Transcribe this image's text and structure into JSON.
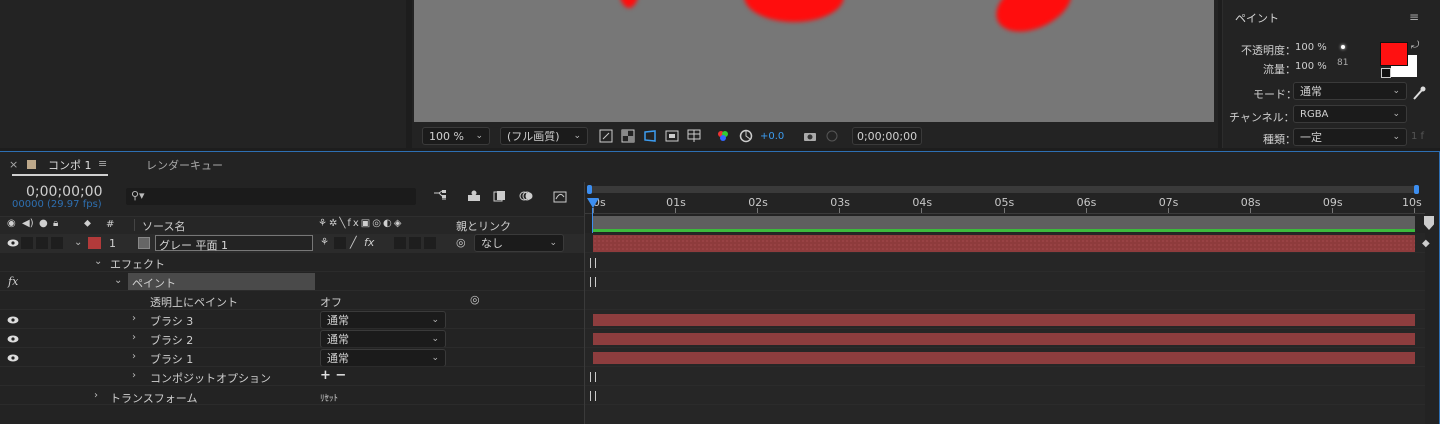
{
  "viewer": {
    "zoom": "100 %",
    "resolution": "(フル画質)",
    "exposure": "+0.0",
    "timecode": "0;00;00;00"
  },
  "paint_panel": {
    "title": "ペイント",
    "opacity_label": "不透明度：",
    "opacity_value": "100 %",
    "flow_label": "流量：",
    "flow_value": "100 %",
    "brush_size": "81",
    "mode_label": "モード：",
    "mode_value": "通常",
    "channel_label": "チャンネル：",
    "channel_value": "RGBA",
    "type_label": "種類：",
    "type_value": "一定",
    "type_extra": "1 f",
    "fg_color": "#ff0000",
    "bg_color": "#ffffff"
  },
  "tabs": {
    "comp": "コンポ 1",
    "render_queue": "レンダーキュー"
  },
  "timeline": {
    "current_time": "0;00;00;00",
    "frame_info": "00000 (29.97 fps)",
    "search_placeholder": "",
    "ruler": [
      "0s",
      "01s",
      "02s",
      "03s",
      "04s",
      "05s",
      "06s",
      "07s",
      "08s",
      "09s",
      "10s"
    ]
  },
  "columns": {
    "num": "#",
    "source_name": "ソース名",
    "parent_link": "親とリンク"
  },
  "layer": {
    "num": "1",
    "name": "グレー 平面 1",
    "parent": "なし",
    "label_color": "#b23a3a"
  },
  "props": {
    "effects": "エフェクト",
    "fx": "fx",
    "paint": "ペイント",
    "paint_on_transparent": "透明上にペイント",
    "paint_on_transparent_value": "オフ",
    "brush3": "ブラシ 3",
    "brush2": "ブラシ 2",
    "brush1": "ブラシ 1",
    "blend_mode": "通常",
    "composite": "コンポジットオプション",
    "composite_value": "+ −",
    "transform": "トランスフォーム",
    "reset": "ﾘｾｯﾄ"
  }
}
